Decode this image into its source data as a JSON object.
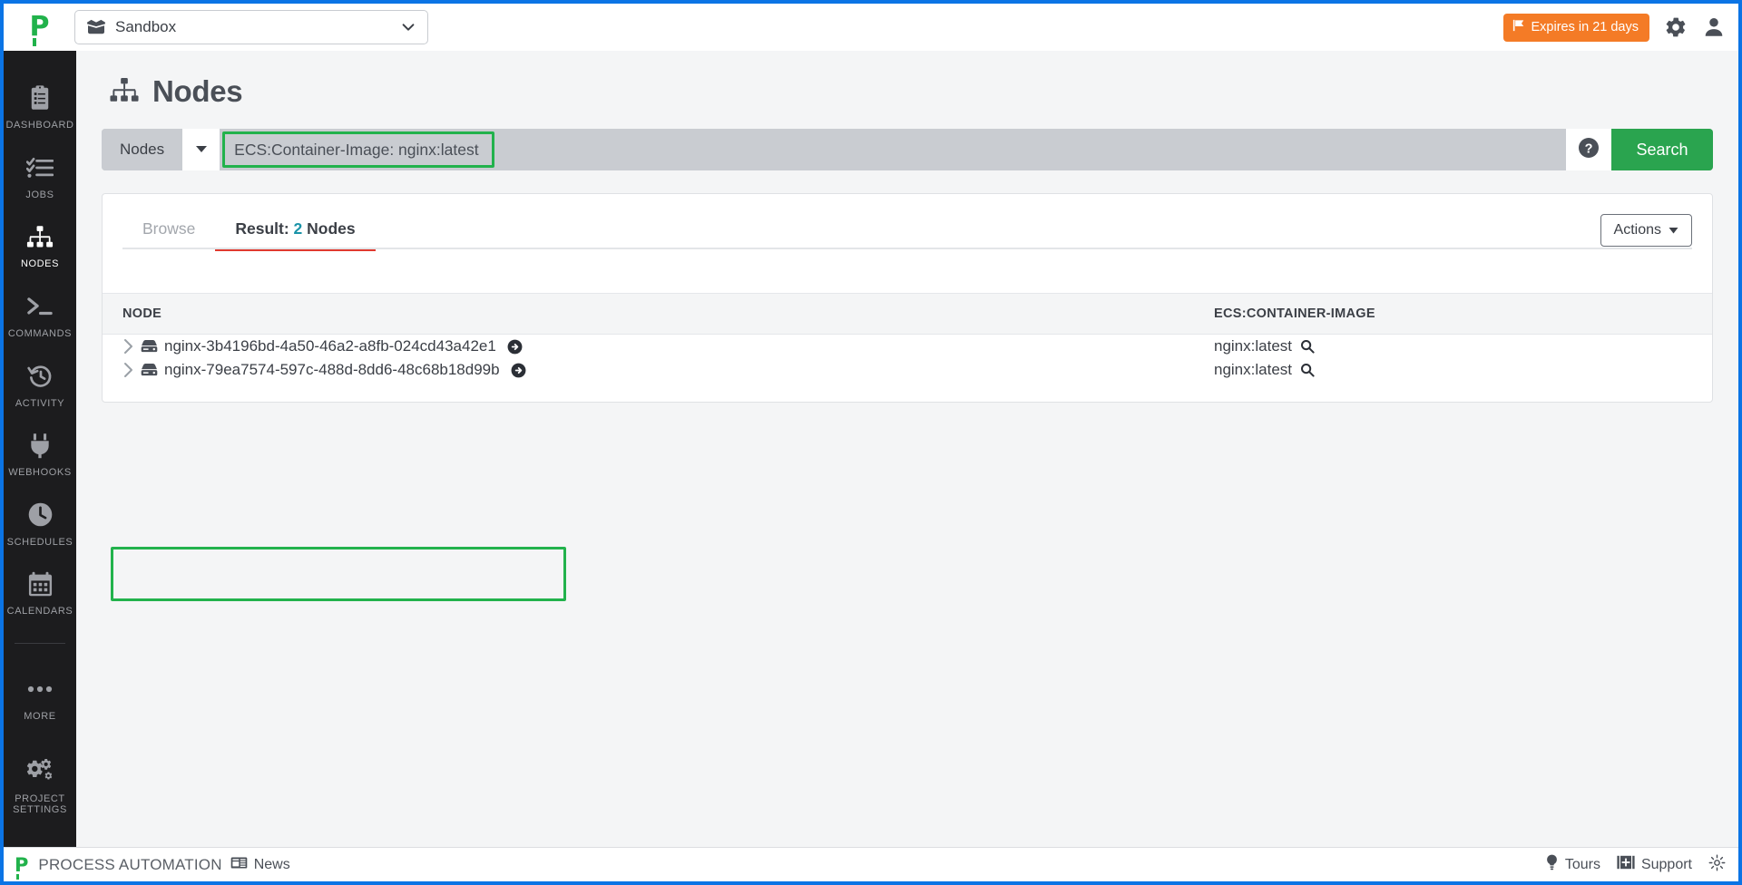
{
  "topbar": {
    "logo_alt": "Process Automation",
    "project": {
      "icon": "box-icon",
      "name": "Sandbox",
      "caret": "chevron-down-icon"
    },
    "expires_badge": {
      "icon": "flag-icon",
      "label": "Expires in 21 days",
      "color": "#f47b26"
    },
    "gear_icon": "gear-icon",
    "user_icon": "user-icon"
  },
  "sidebar": {
    "items": [
      {
        "label": "DASHBOARD",
        "icon": "clipboard-list-icon",
        "active": false
      },
      {
        "label": "JOBS",
        "icon": "task-list-icon",
        "active": false
      },
      {
        "label": "NODES",
        "icon": "sitemap-icon",
        "active": true
      },
      {
        "label": "COMMANDS",
        "icon": "terminal-icon",
        "active": false
      },
      {
        "label": "ACTIVITY",
        "icon": "history-clock-icon",
        "active": false
      },
      {
        "label": "WEBHOOKS",
        "icon": "plug-icon",
        "active": false
      },
      {
        "label": "SCHEDULES",
        "icon": "clock-icon",
        "active": false
      },
      {
        "label": "CALENDARS",
        "icon": "calendar-icon",
        "active": false
      },
      {
        "label": "MORE",
        "icon": "ellipsis-icon",
        "active": false
      },
      {
        "label": "PROJECT SETTINGS",
        "icon": "gears-icon",
        "active": false
      }
    ]
  },
  "page": {
    "title": "Nodes",
    "title_icon": "sitemap-icon"
  },
  "search": {
    "type_label": "Nodes",
    "type_caret": "caret-down-icon",
    "query_value": "ECS:Container-Image: nginx:latest",
    "query_placeholder": "Enter a node filter",
    "help_icon": "question-circle-icon",
    "search_button": "Search",
    "search_button_color": "#2aa44f",
    "highlight_color": "#22b24c"
  },
  "card": {
    "tabs": [
      {
        "label": "Browse",
        "active": false
      },
      {
        "label": "Result:",
        "count": "2",
        "suffix": "Nodes",
        "active": true
      }
    ],
    "actions_button": {
      "label": "Actions",
      "caret": "caret-down-icon"
    },
    "table": {
      "columns": [
        "NODE",
        "ECS:CONTAINER-IMAGE"
      ],
      "rows": [
        {
          "expand_icon": "chevron-right-icon",
          "node_icon": "server-icon",
          "node": "nginx-3b4196bd-4a50-46a2-a8fb-024cd43a42e1",
          "go_icon": "arrow-circle-right-icon",
          "image": "nginx:latest",
          "image_search_icon": "magnifier-icon"
        },
        {
          "expand_icon": "chevron-right-icon",
          "node_icon": "server-icon",
          "node": "nginx-79ea7574-597c-488d-8dd6-48c68b18d99b",
          "go_icon": "arrow-circle-right-icon",
          "image": "nginx:latest",
          "image_search_icon": "magnifier-icon"
        }
      ]
    }
  },
  "footer": {
    "brand": "PROCESS AUTOMATION",
    "news": {
      "icon": "news-icon",
      "label": "News"
    },
    "tours": {
      "icon": "lightbulb-icon",
      "label": "Tours"
    },
    "support": {
      "icon": "support-icon",
      "label": "Support"
    },
    "settings_icon": "gear-icon"
  }
}
